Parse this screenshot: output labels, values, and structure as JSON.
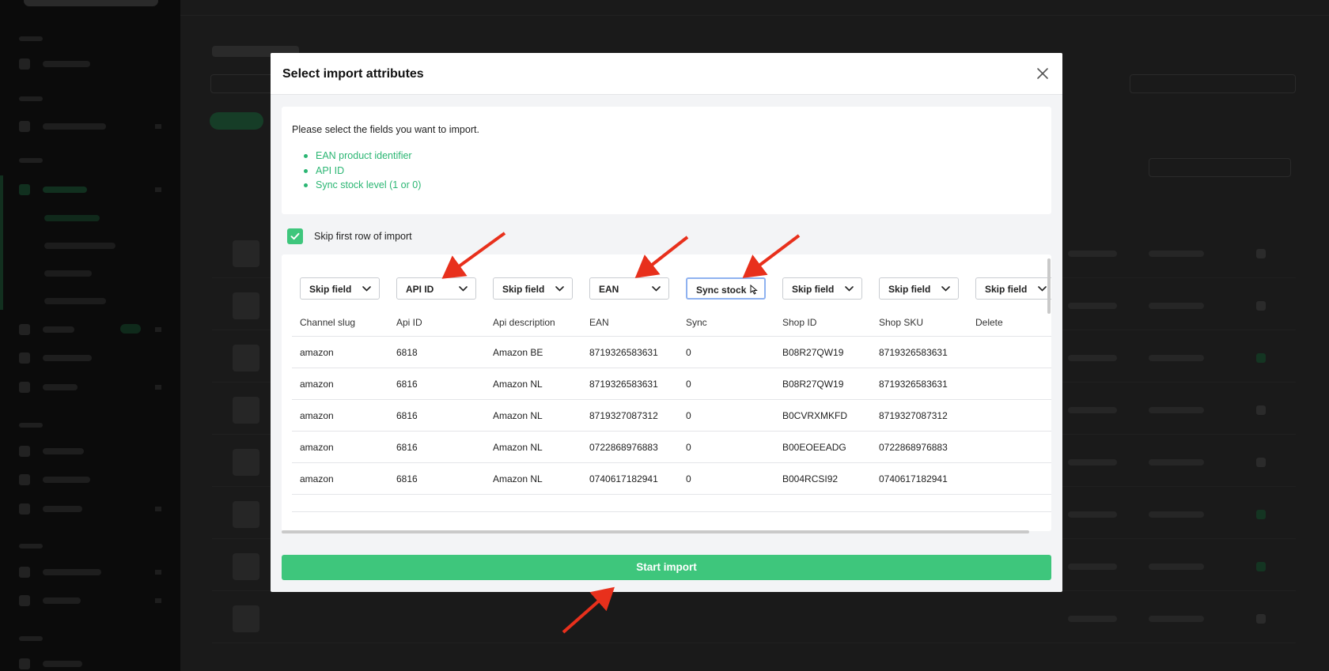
{
  "modal": {
    "title": "Select import attributes",
    "close_icon": "close-icon",
    "instructions": "Please select the fields you want to import.",
    "fields": [
      "EAN product identifier",
      "API ID",
      "Sync stock level (1 or 0)"
    ],
    "skip_first_row": {
      "label": "Skip first row of import",
      "checked": true
    },
    "column_selects": [
      "Skip field",
      "API ID",
      "Skip field",
      "EAN",
      "Sync stock",
      "Skip field",
      "Skip field",
      "Skip field"
    ],
    "active_select_index": 4,
    "columns": [
      "Channel slug",
      "Api ID",
      "Api description",
      "EAN",
      "Sync",
      "Shop ID",
      "Shop SKU",
      "Delete"
    ],
    "rows": [
      [
        "amazon",
        "6818",
        "Amazon BE",
        "8719326583631",
        "0",
        "B08R27QW19",
        "8719326583631",
        ""
      ],
      [
        "amazon",
        "6816",
        "Amazon NL",
        "8719326583631",
        "0",
        "B08R27QW19",
        "8719326583631",
        ""
      ],
      [
        "amazon",
        "6816",
        "Amazon NL",
        "8719327087312",
        "0",
        "B0CVRXMKFD",
        "8719327087312",
        ""
      ],
      [
        "amazon",
        "6816",
        "Amazon NL",
        "0722868976883",
        "0",
        "B00EOEEADG",
        "0722868976883",
        ""
      ],
      [
        "amazon",
        "6816",
        "Amazon NL",
        "0740617182941",
        "0",
        "B004RCSI92",
        "0740617182941",
        ""
      ]
    ],
    "start_button": "Start import"
  },
  "colors": {
    "accent_green": "#3ec67c",
    "list_green": "#2bb673",
    "annotation_red": "#e8301c"
  }
}
